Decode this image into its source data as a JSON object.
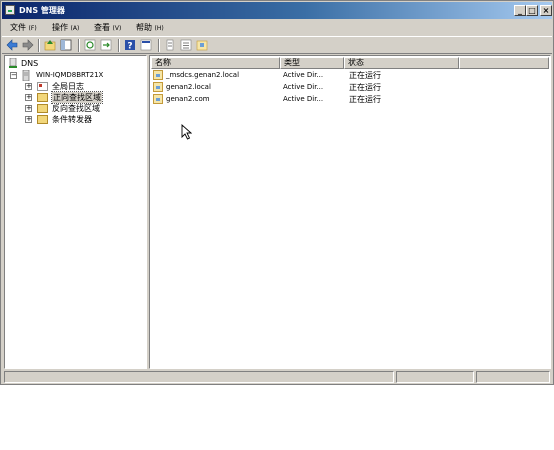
{
  "window": {
    "title": "DNS 管理器"
  },
  "titlebar": {
    "min": "_",
    "max": "□",
    "close": "×"
  },
  "menubar": [
    {
      "label": "文件",
      "key": "(F)"
    },
    {
      "label": "操作",
      "key": "(A)"
    },
    {
      "label": "查看",
      "key": "(V)"
    },
    {
      "label": "帮助",
      "key": "(H)"
    }
  ],
  "toolbar": [
    "back-icon",
    "forward-icon",
    "up-icon",
    "show-hide-tree-icon",
    "refresh-icon",
    "export-icon",
    "help-icon",
    "properties-icon",
    "column-icon",
    "list-icon",
    "new-zone-icon"
  ],
  "tree": {
    "root": "DNS",
    "server": "WIN-IQMD8BRT21X",
    "items": [
      "全局日志",
      "正向查找区域",
      "反向查找区域",
      "条件转发器"
    ],
    "selected": "正向查找区域"
  },
  "list": {
    "columns": [
      "名称",
      "类型",
      "状态"
    ],
    "rows": [
      {
        "name": "_msdcs.genan2.local",
        "type": "Active Dir...",
        "status": "正在运行"
      },
      {
        "name": "genan2.local",
        "type": "Active Dir...",
        "status": "正在运行"
      },
      {
        "name": "genan2.com",
        "type": "Active Dir...",
        "status": "正在运行"
      }
    ]
  }
}
